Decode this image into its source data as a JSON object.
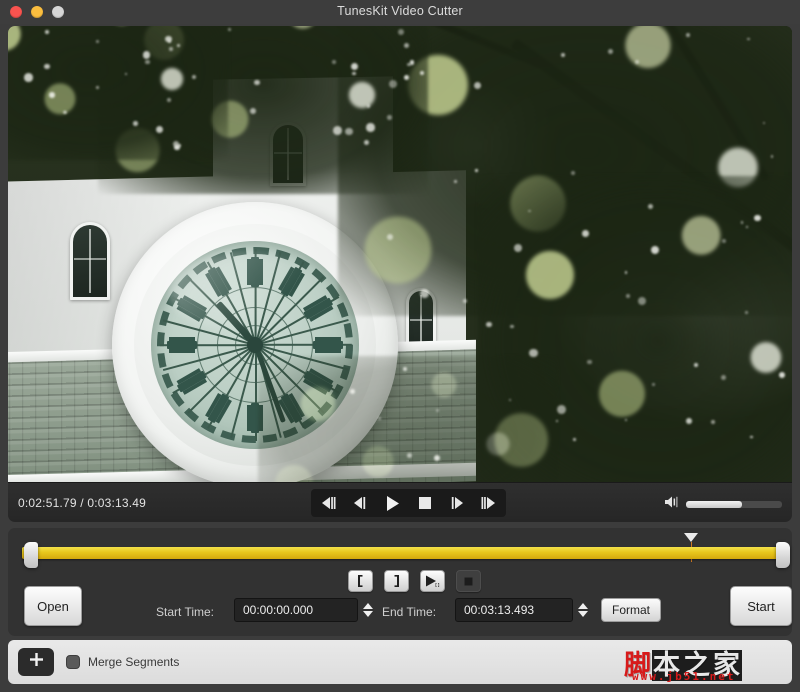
{
  "window": {
    "title": "TunesKit Video Cutter",
    "traffic_lights": [
      {
        "name": "close",
        "color": "#f9534f"
      },
      {
        "name": "minimize",
        "color": "#fbbe3f"
      },
      {
        "name": "maximize",
        "color": "#d6d6d6"
      }
    ]
  },
  "player": {
    "current_time": "0:02:51.79",
    "total_time": "0:03:13.49",
    "time_display": "0:02:51.79 / 0:03:13.49",
    "volume_percent": 58,
    "volume_icon": "speaker-icon",
    "controls": [
      {
        "name": "step-back-fast-button",
        "icon": "previous-frames-icon",
        "label": "Step Back Fast"
      },
      {
        "name": "step-back-button",
        "icon": "previous-frame-icon",
        "label": "Step Back"
      },
      {
        "name": "play-button",
        "icon": "play-icon",
        "label": "Play"
      },
      {
        "name": "stop-button",
        "icon": "stop-icon",
        "label": "Stop"
      },
      {
        "name": "step-forward-button",
        "icon": "next-frame-icon",
        "label": "Step Forward"
      },
      {
        "name": "step-forward-fast-button",
        "icon": "next-frames-icon",
        "label": "Step Forward Fast"
      }
    ]
  },
  "timeline": {
    "playhead_percent": 88.5,
    "selection_start_percent": 0,
    "selection_end_percent": 100,
    "bar_color": "#e8c71c",
    "playhead_marker_color": "#d07a22",
    "trim_buttons": [
      {
        "name": "set-start-point-button",
        "icon": "bracket-open-icon",
        "label": "Set Start",
        "disabled": false
      },
      {
        "name": "set-end-point-button",
        "icon": "bracket-close-icon",
        "label": "Set End",
        "disabled": false
      },
      {
        "name": "preview-selection-button",
        "icon": "play-selection-icon",
        "label": "Preview Selection",
        "disabled": false
      },
      {
        "name": "stop-preview-button",
        "icon": "stop-icon",
        "label": "Stop Preview",
        "disabled": true
      }
    ]
  },
  "editor": {
    "open_label": "Open",
    "start_time_label": "Start Time:",
    "start_time_value": "00:00:00.000",
    "end_time_label": "End Time:",
    "end_time_value": "00:03:13.493",
    "format_label": "Format",
    "start_label": "Start"
  },
  "segments": {
    "add_icon": "plus-icon",
    "merge_label": "Merge Segments",
    "merge_checked": false
  },
  "watermark": {
    "text_cn": "脚本之家",
    "url": "www.jb51.net",
    "color": "#d71a1a"
  }
}
